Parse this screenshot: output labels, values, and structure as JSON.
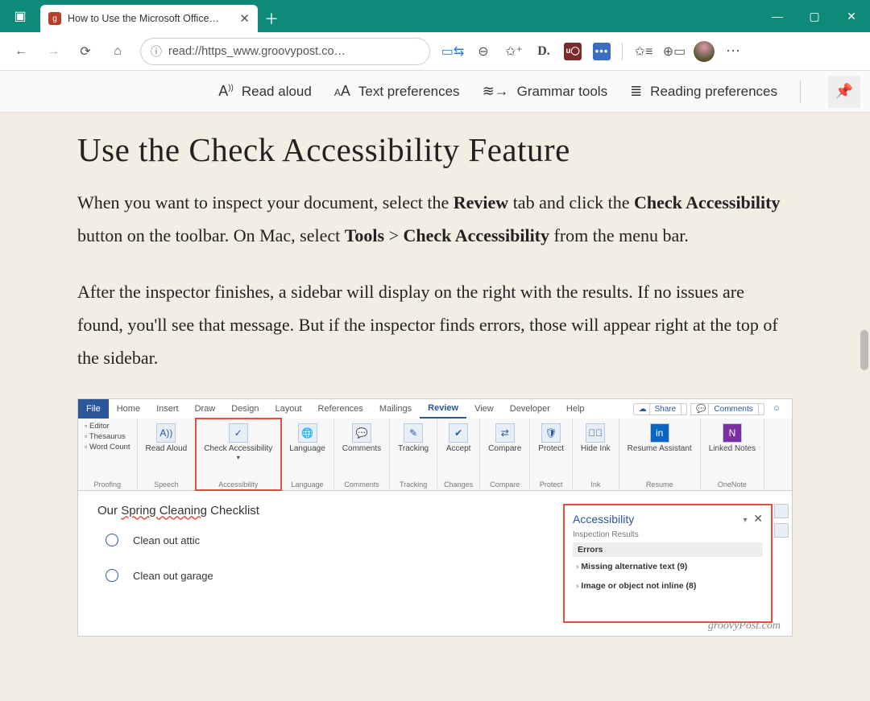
{
  "window": {
    "tab_title": "How to Use the Microsoft Office…",
    "favicon_char": "g"
  },
  "addr": {
    "url_display": "read://https_www.groovypost.co…"
  },
  "reader_toolbar": {
    "read_aloud": "Read aloud",
    "text_prefs": "Text preferences",
    "grammar": "Grammar tools",
    "reading_prefs": "Reading preferences"
  },
  "article": {
    "heading": "Use the Check Accessibility Feature",
    "p1_a": "When you want to inspect your document, select the ",
    "p1_b1": "Review",
    "p1_c": " tab and click the ",
    "p1_b2": "Check Accessibility",
    "p1_d": " button on the toolbar. On Mac, select ",
    "p1_b3": "Tools",
    "p1_e": " > ",
    "p1_b4": "Check Accessibility",
    "p1_f": " from the menu bar.",
    "p2": "After the inspector finishes, a sidebar will display on the right with the results. If no issues are found, you'll see that message. But if the inspector finds errors, those will appear right at the top of the sidebar."
  },
  "word": {
    "tabs": {
      "file": "File",
      "home": "Home",
      "insert": "Insert",
      "draw": "Draw",
      "design": "Design",
      "layout": "Layout",
      "references": "References",
      "mailings": "Mailings",
      "review": "Review",
      "view": "View",
      "developer": "Developer",
      "help": "Help"
    },
    "share": "Share",
    "comments": "Comments",
    "ribbon": {
      "editor": "Editor",
      "thesaurus": "Thesaurus",
      "wordcount": "Word Count",
      "proofing": "Proofing",
      "read_aloud": "Read Aloud",
      "speech": "Speech",
      "check_acc": "Check Accessibility",
      "accessibility": "Accessibility",
      "language": "Language",
      "comments_btn": "Comments",
      "tracking": "Tracking",
      "accept": "Accept",
      "changes": "Changes",
      "compare": "Compare",
      "protect": "Protect",
      "hide_ink": "Hide Ink",
      "ink": "Ink",
      "resume_asst": "Resume Assistant",
      "resume": "Resume",
      "linked_notes": "Linked Notes",
      "onenote": "OneNote"
    },
    "doc": {
      "title_a": "Our ",
      "title_u": "Spring Cleaning",
      "title_b": " Checklist",
      "item1": "Clean out attic",
      "item2": "Clean out garage"
    },
    "pane": {
      "title": "Accessibility",
      "sub": "Inspection Results",
      "errors": "Errors",
      "e1": "Missing alternative text (9)",
      "e2": "Image or object not inline (8)"
    },
    "watermark": "groovyPost.com"
  }
}
